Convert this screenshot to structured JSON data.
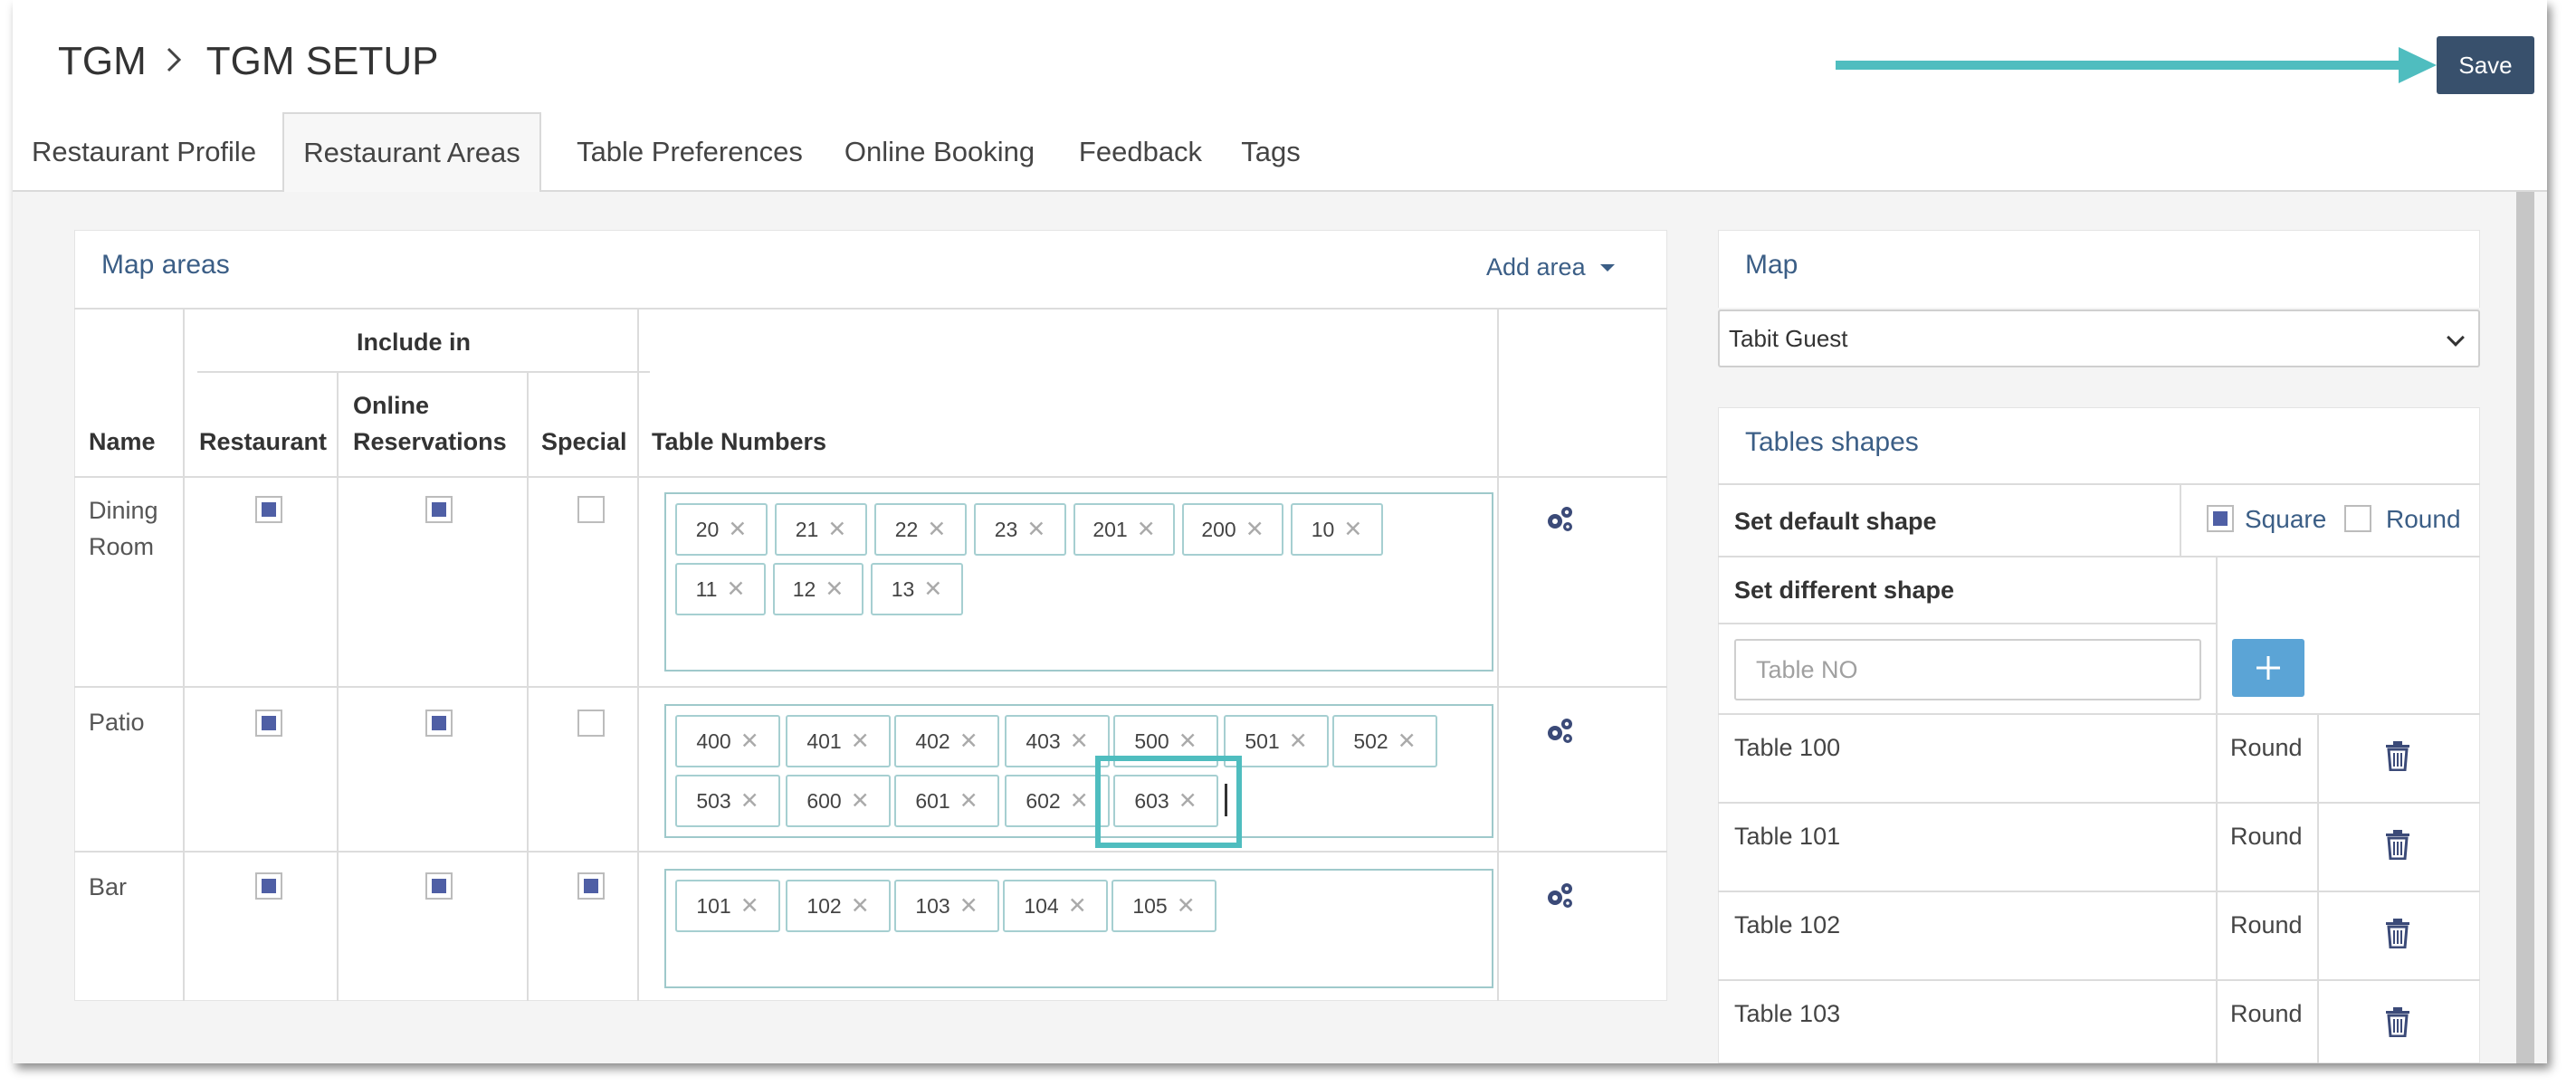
{
  "header": {
    "breadcrumb_root": "TGM",
    "breadcrumb_separator": ">",
    "breadcrumb_current": "TGM SETUP",
    "save_label": "Save"
  },
  "tabs": [
    {
      "label": "Restaurant Profile",
      "active": false
    },
    {
      "label": "Restaurant Areas",
      "active": true
    },
    {
      "label": "Table Preferences",
      "active": false
    },
    {
      "label": "Online Booking",
      "active": false
    },
    {
      "label": "Feedback",
      "active": false
    },
    {
      "label": "Tags",
      "active": false
    }
  ],
  "map_areas": {
    "title": "Map areas",
    "add_area_label": "Add area",
    "columns": {
      "include_in": "Include in",
      "name": "Name",
      "restaurant": "Restaurant",
      "online_line1": "Online",
      "online_line2": "Reservations",
      "special": "Special",
      "table_numbers": "Table Numbers"
    },
    "rows": [
      {
        "name_line1": "Dining",
        "name_line2": "Room",
        "restaurant": true,
        "online_reservations": true,
        "special": false,
        "tables": [
          "20",
          "21",
          "22",
          "23",
          "201",
          "200",
          "10",
          "11",
          "12",
          "13"
        ]
      },
      {
        "name_line1": "Patio",
        "name_line2": "",
        "restaurant": true,
        "online_reservations": true,
        "special": false,
        "tables": [
          "400",
          "401",
          "402",
          "403",
          "500",
          "501",
          "502",
          "503",
          "600",
          "601",
          "602",
          "603"
        ]
      },
      {
        "name_line1": "Bar",
        "name_line2": "",
        "restaurant": true,
        "online_reservations": true,
        "special": true,
        "tables": [
          "101",
          "102",
          "103",
          "104",
          "105"
        ]
      }
    ]
  },
  "map": {
    "title": "Map",
    "selected": "Tabit Guest"
  },
  "tables_shapes": {
    "title": "Tables shapes",
    "default_label": "Set default shape",
    "square_label": "Square",
    "round_label": "Round",
    "square_checked": true,
    "round_checked": false,
    "different_label": "Set different shape",
    "table_placeholder": "Table NO",
    "rows": [
      {
        "table": "Table 100",
        "shape": "Round"
      },
      {
        "table": "Table 101",
        "shape": "Round"
      },
      {
        "table": "Table 102",
        "shape": "Round"
      },
      {
        "table": "Table 103",
        "shape": "Round"
      }
    ]
  },
  "colors": {
    "accent_teal": "#4fbdbf",
    "save_button": "#38506c",
    "link_blue": "#3b5e86",
    "checkbox_fill": "#4f5fa5",
    "plus_button": "#5ba4d6"
  },
  "icons": {
    "row_settings": "gears-icon",
    "delete": "trash-icon",
    "add": "plus-icon"
  }
}
